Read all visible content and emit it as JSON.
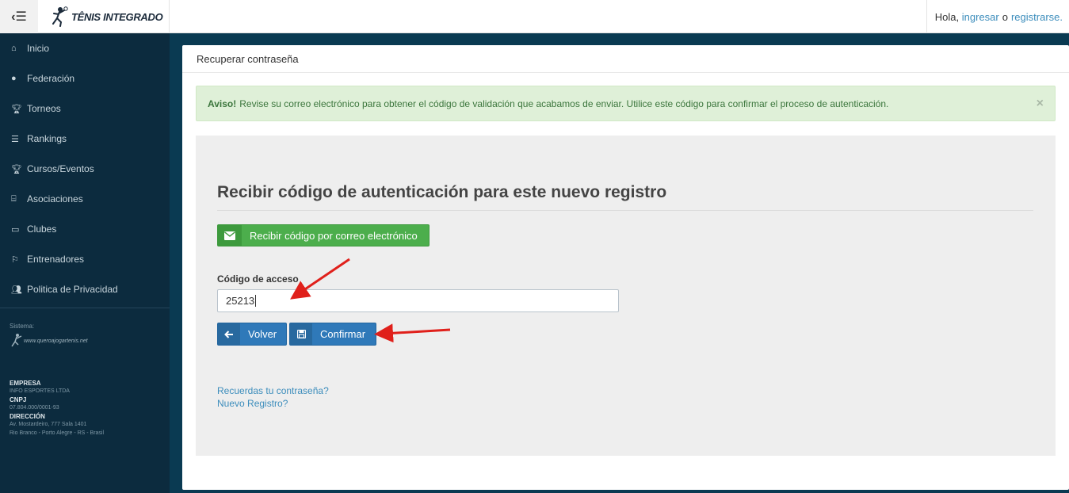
{
  "topbar": {
    "logo_text": "TÊNIS INTEGRADO",
    "greeting": "Hola,",
    "login_link": "ingresar",
    "or_text": "o",
    "register_link": "registrarse."
  },
  "sidebar": {
    "items": [
      {
        "label": "Inicio",
        "icon": "home-icon"
      },
      {
        "label": "Federación",
        "icon": "globe-icon"
      },
      {
        "label": "Torneos",
        "icon": "trophy-icon"
      },
      {
        "label": "Rankings",
        "icon": "list-icon"
      },
      {
        "label": "Cursos/Eventos",
        "icon": "trophy-icon"
      },
      {
        "label": "Asociaciones",
        "icon": "bank-icon"
      },
      {
        "label": "Clubes",
        "icon": "folder-icon"
      },
      {
        "label": "Entrenadores",
        "icon": "flag-icon"
      },
      {
        "label": "Politica de Privacidad",
        "icon": "users-icon"
      }
    ],
    "system_label": "Sistema:",
    "system_logo": "www.queroajogartenis.net",
    "company_heading": "EMPRESA",
    "company_name": "INFO ESPORTES LTDA",
    "cnpj_heading": "CNPJ",
    "cnpj_value": "07.804.000/0001-93",
    "address_heading": "DIRECCIÓN",
    "address_line1": "Av. Mostardeiro, 777 Sala 1401",
    "address_line2": "Rio Branco - Porto Alegre - RS - Brasil"
  },
  "panel": {
    "title": "Recuperar contraseña",
    "alert_strong": "Aviso!",
    "alert_text": "Revise su correo electrónico para obtener el código de validación que acabamos de enviar. Utilice este código para confirmar el proceso de autenticación.",
    "alert_close": "×",
    "heading": "Recibir código de autenticación para este nuevo registro",
    "email_button": "Recibir código por correo electrónico",
    "code_label": "Código de acceso",
    "code_value": "25213",
    "back_button": "Volver",
    "confirm_button": "Confirmar",
    "link_forgot": "Recuerdas tu contraseña?",
    "link_register": "Nuevo Registro?"
  },
  "colors": {
    "sidebar_bg": "#0c2b3e",
    "success_green": "#4cae4c",
    "primary_blue": "#2f79b9",
    "alert_bg": "#dff0d8",
    "annotation_arrow": "#e0201b"
  }
}
